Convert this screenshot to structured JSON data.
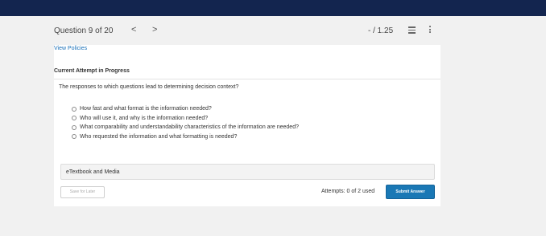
{
  "header": {
    "question_label": "Question 9 of 20",
    "prev_icon": "chevron-left-icon",
    "next_icon": "chevron-right-icon",
    "prev_glyph": "<",
    "next_glyph": ">",
    "score": "- / 1.25",
    "list_icon": "question-list-icon",
    "more_icon": "kebab-menu-icon"
  },
  "card": {
    "policies_link": "View Policies",
    "attempt_status": "Current Attempt in Progress",
    "question_text": "The responses to which questions lead to determining decision context?",
    "options": [
      "How fast and what format is the information needed?",
      "Who will use it, and why is the information needed?",
      "What comparability and understandability characteristics of the information are needed?",
      "Who requested the information and what formatting is needed?"
    ],
    "resources_label": "eTextbook and Media",
    "save_label": "Save for Later",
    "attempts_text": "Attempts: 0 of 2 used",
    "submit_label": "Submit Answer"
  },
  "colors": {
    "topbar": "#13254f",
    "link": "#1a70b8",
    "submit": "#1a78b5"
  }
}
